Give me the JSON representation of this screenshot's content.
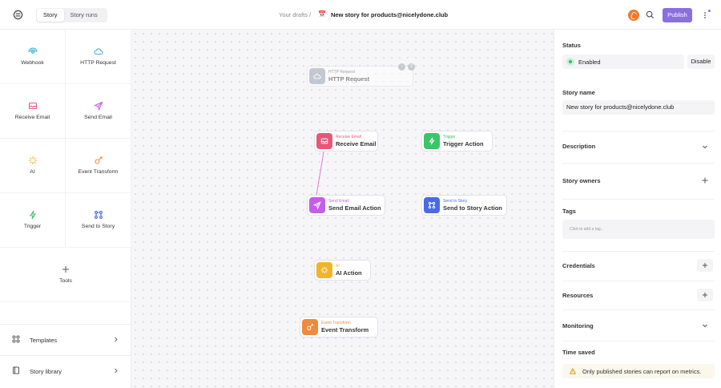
{
  "header": {
    "tabs": [
      {
        "label": "Story",
        "active": true
      },
      {
        "label": "Story runs",
        "active": false
      }
    ],
    "breadcrumb": "Your drafts /",
    "story_emoji": "📅",
    "story_title": "New story for products@nicelydone.club",
    "publish_label": "Publish"
  },
  "actions": [
    {
      "label": "Webhook",
      "icon": "webhook-icon",
      "color": "#2bb3c8"
    },
    {
      "label": "HTTP Request",
      "icon": "cloud-icon",
      "color": "#4aa6e8"
    },
    {
      "label": "Receive Email",
      "icon": "inbox-icon",
      "color": "#e8567a"
    },
    {
      "label": "Send Email",
      "icon": "send-icon",
      "color": "#c45ee8"
    },
    {
      "label": "AI",
      "icon": "sparkle-icon",
      "color": "#f0b429"
    },
    {
      "label": "Event Transform",
      "icon": "transform-icon",
      "color": "#f08a3c"
    },
    {
      "label": "Trigger",
      "icon": "trigger-icon",
      "color": "#3cc46a"
    },
    {
      "label": "Send to Story",
      "icon": "story-icon",
      "color": "#4a6ae8"
    }
  ],
  "tools_label": "Tools",
  "bottom_links": [
    {
      "label": "Templates",
      "icon": "templates-icon"
    },
    {
      "label": "Story library",
      "icon": "book-icon"
    }
  ],
  "nodes": [
    {
      "type": "HTTP Request",
      "name": "HTTP Request",
      "color": "#9aa3b5",
      "faded": true
    },
    {
      "type": "Receive Email",
      "name": "Receive Email",
      "color": "#e8567a"
    },
    {
      "type": "Trigger",
      "name": "Trigger Action",
      "color": "#3cc46a"
    },
    {
      "type": "Send Email",
      "name": "Send Email Action",
      "color": "#c45ee8"
    },
    {
      "type": "Send to Story",
      "name": "Send to Story Action",
      "color": "#4a6ae8"
    },
    {
      "type": "AI",
      "name": "AI Action",
      "color": "#f0b429"
    },
    {
      "type": "Event Transform",
      "name": "Event Transform",
      "color": "#f08a3c"
    }
  ],
  "node_badges": [
    "↑",
    "2"
  ],
  "sidebar": {
    "status_label": "Status",
    "status_value": "Enabled",
    "disable_label": "Disable",
    "story_name_label": "Story name",
    "story_name_value": "New story for products@nicelydone.club",
    "description_label": "Description",
    "owners_label": "Story owners",
    "tags_label": "Tags",
    "tags_placeholder": "Click to add a tag...",
    "credentials_label": "Credentials",
    "resources_label": "Resources",
    "monitoring_label": "Monitoring",
    "time_saved_label": "Time saved",
    "notice_text": "Only published stories can report on metrics."
  }
}
